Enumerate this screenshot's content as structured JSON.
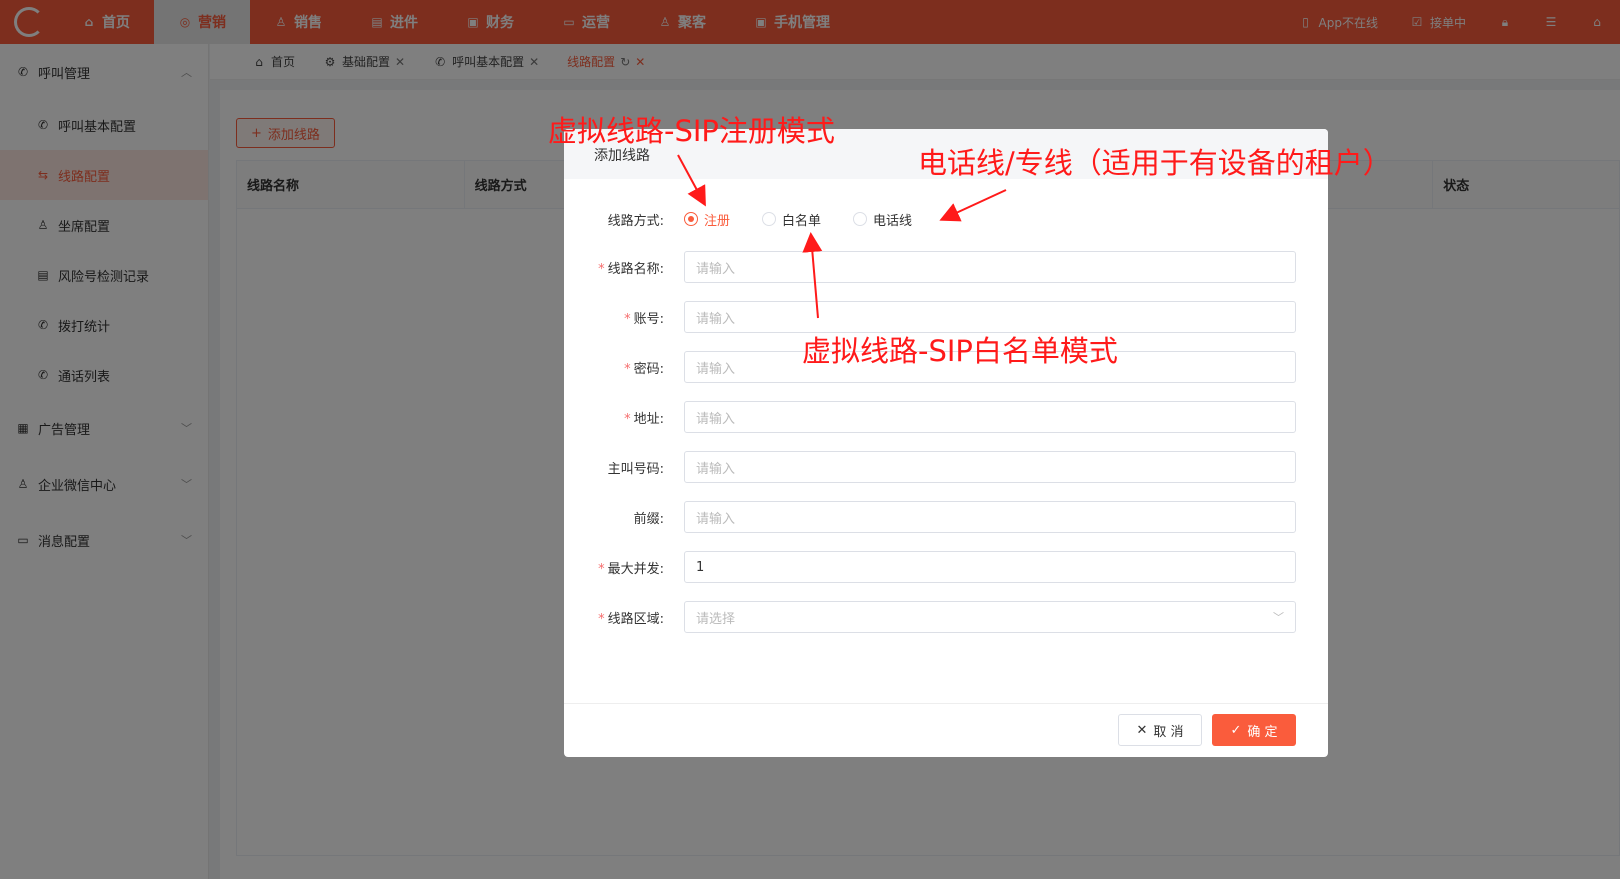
{
  "topnav": {
    "items": [
      {
        "label": "首页",
        "icon": "home-icon"
      },
      {
        "label": "营销",
        "icon": "marketing-icon"
      },
      {
        "label": "销售",
        "icon": "user-icon"
      },
      {
        "label": "进件",
        "icon": "document-icon"
      },
      {
        "label": "财务",
        "icon": "finance-icon"
      },
      {
        "label": "运营",
        "icon": "operation-icon"
      },
      {
        "label": "聚客",
        "icon": "customer-icon"
      },
      {
        "label": "手机管理",
        "icon": "phone-manage-icon"
      }
    ],
    "active_index": 1,
    "right": {
      "app_status": "App不在线",
      "order_status": "接单中"
    }
  },
  "sidebar": {
    "group_call": "呼叫管理",
    "items": [
      "呼叫基本配置",
      "线路配置",
      "坐席配置",
      "风险号检测记录",
      "拨打统计",
      "通话列表"
    ],
    "active_index": 1,
    "group_ads": "广告管理",
    "group_wecom": "企业微信中心",
    "group_msg": "消息配置"
  },
  "tabs": [
    {
      "label": "首页"
    },
    {
      "label": "基础配置"
    },
    {
      "label": "呼叫基本配置"
    },
    {
      "label": "线路配置"
    }
  ],
  "main": {
    "add_button": "添加线路",
    "columns": [
      "线路名称",
      "线路方式",
      "状态"
    ]
  },
  "dialog": {
    "title": "添加线路",
    "mode_label": "线路方式:",
    "modes": [
      "注册",
      "白名单",
      "电话线"
    ],
    "selected_mode": "注册",
    "fields": {
      "name": {
        "label": "线路名称:",
        "placeholder": "请输入"
      },
      "account": {
        "label": "账号:",
        "placeholder": "请输入"
      },
      "password": {
        "label": "密码:",
        "placeholder": "请输入"
      },
      "address": {
        "label": "地址:",
        "placeholder": "请输入"
      },
      "caller": {
        "label": "主叫号码:",
        "placeholder": "请输入"
      },
      "prefix": {
        "label": "前缀:",
        "placeholder": "请输入"
      },
      "concurrency": {
        "label": "最大并发:",
        "value": "1"
      },
      "region": {
        "label": "线路区域:",
        "placeholder": "请选择"
      }
    },
    "cancel": "取 消",
    "confirm": "确 定"
  },
  "annotations": {
    "register": "虚拟线路-SIP注册模式",
    "phone_line": "电话线/专线（适用于有设备的租户）",
    "whitelist": "虚拟线路-SIP白名单模式"
  },
  "colors": {
    "accent": "#fa5c3c",
    "annotation": "#ff1a1a",
    "required": "#f56c6c"
  }
}
